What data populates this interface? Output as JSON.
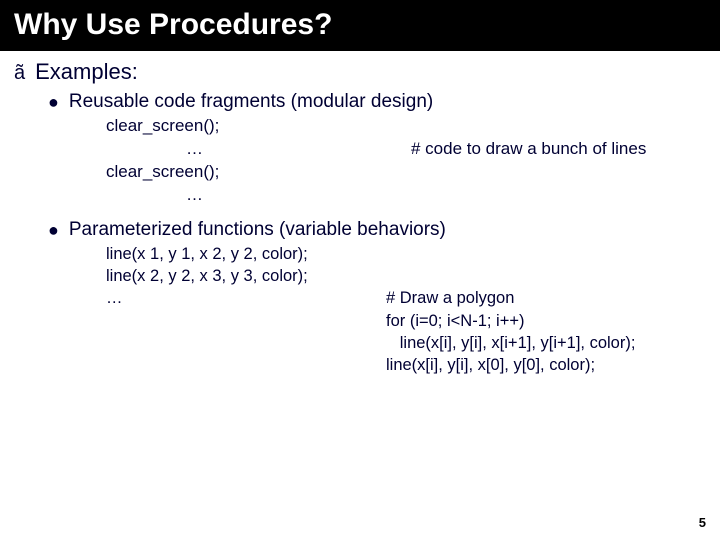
{
  "title": "Why Use Procedures?",
  "bullet_main": "ã",
  "examples_label": "Examples:",
  "bullet_dot": "●",
  "item1": {
    "label": "Reusable code fragments (modular design)",
    "code": {
      "l1": "clear_screen();",
      "l2_left": "…",
      "l2_right": "# code to draw a bunch of lines",
      "l3": "clear_screen();",
      "l4": "…"
    }
  },
  "item2": {
    "label": "Parameterized functions (variable behaviors)",
    "code": {
      "l1": "line(x 1, y 1, x 2, y 2, color);",
      "l2": "line(x 2, y 2, x 3, y 3, color);",
      "l3_left": "…",
      "l3_right": "# Draw a polygon",
      "l4_right": "for (i=0; i<N-1; i++)",
      "l5_right": "   line(x[i], y[i], x[i+1], y[i+1], color);",
      "l6_right": "line(x[i], y[i], x[0], y[0], color);"
    }
  },
  "page_number": "5"
}
